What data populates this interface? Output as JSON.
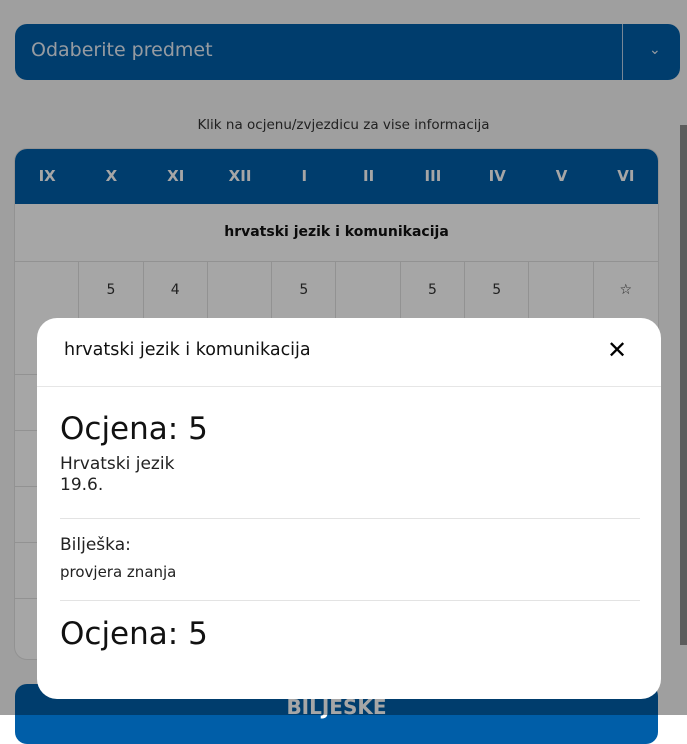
{
  "subject_select": {
    "placeholder": "Odaberite predmet",
    "chevron_icon": "chevron-down-icon"
  },
  "hint": "Klik na ocjenu/zvjezdicu za vise informacija",
  "table": {
    "months": [
      "IX",
      "X",
      "XI",
      "XII",
      "I",
      "II",
      "III",
      "IV",
      "V",
      "VI"
    ],
    "subject": "hrvatski jezik i komunikacija",
    "grades": [
      "",
      "5",
      "4",
      "",
      "5",
      "",
      "5",
      "5",
      "",
      "☆"
    ]
  },
  "bottom_button": {
    "label": "BILJEŠKE"
  },
  "modal": {
    "title": "hrvatski jezik i komunikacija",
    "close_glyph": "✕",
    "entries": [
      {
        "grade": "Ocjena: 5",
        "subject": "Hrvatski jezik",
        "date": "19.6."
      },
      {
        "note_label": "Bilješka:",
        "note": "provjera znanja"
      },
      {
        "grade": "Ocjena: 5"
      }
    ]
  },
  "colors": {
    "accent": "#005ea8"
  }
}
